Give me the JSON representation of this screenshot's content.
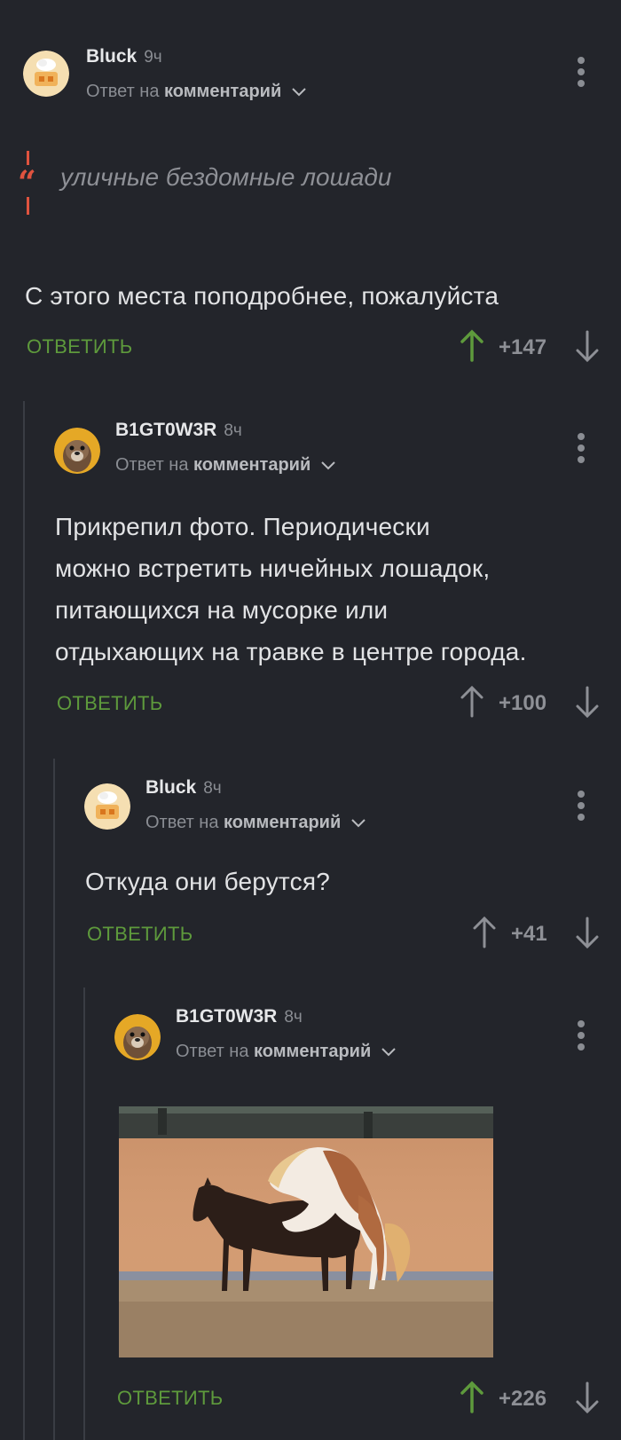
{
  "comments": [
    {
      "username": "Bluck",
      "time": "9ч",
      "reply_prefix": "Ответ на",
      "reply_link": "комментарий",
      "quote": "уличные бездомные лошади",
      "text": "С этого места поподробнее, пожалуйста",
      "reply_label": "ОТВЕТИТЬ",
      "score": "+147",
      "upvoted": true
    },
    {
      "username": "B1GT0W3R",
      "time": "8ч",
      "reply_prefix": "Ответ на",
      "reply_link": "комментарий",
      "text_lines": [
        "Прикрепил фото. Периодически",
        "можно встретить ничейных лошадок,",
        "питающихся на мусорке или",
        "отдыхающих на травке в центре города."
      ],
      "reply_label": "ОТВЕТИТЬ",
      "score": "+100",
      "upvoted": false
    },
    {
      "username": "Bluck",
      "time": "8ч",
      "reply_prefix": "Ответ на",
      "reply_link": "комментарий",
      "text": "Откуда они берутся?",
      "reply_label": "ОТВЕТИТЬ",
      "score": "+41",
      "upvoted": false
    },
    {
      "username": "B1GT0W3R",
      "time": "8ч",
      "reply_prefix": "Ответ на",
      "reply_link": "комментарий",
      "image": "photo-of-two-horses",
      "reply_label": "ОТВЕТИТЬ",
      "score": "+226",
      "upvoted": true
    }
  ],
  "colors": {
    "background": "#23252b",
    "reply_green": "#5e9a3c",
    "upvote_green": "#5e9a3c",
    "quote_red": "#e0533f",
    "muted": "#8a8d93"
  },
  "icons": {
    "more": "kebab-menu-icon",
    "chevron": "chevron-down-icon",
    "upvote": "arrow-up-icon",
    "downvote": "arrow-down-icon",
    "quote": "quote-icon"
  }
}
